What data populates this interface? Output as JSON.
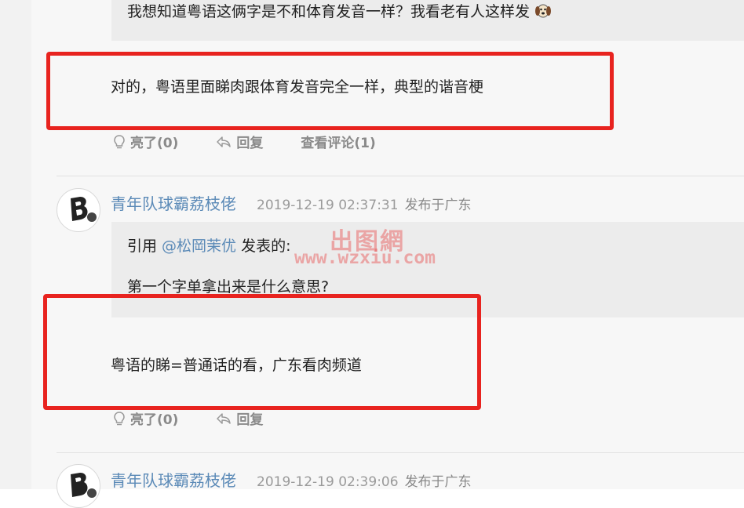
{
  "thread": {
    "quote_top_text": "我想知道粤语这俩字是不和体育发音一样？我看老有人这样发",
    "reply1_text": "对的，粤语里面睇肉跟体育发音完全一样，典型的谐音梗",
    "reply1_actions": {
      "like": "亮了(0)",
      "reply": "回复",
      "view_comments": "查看评论(1)"
    },
    "post2": {
      "username": "青年队球霸荔枝佬",
      "time": "2019-12-19 02:37:31",
      "location": "发布于广东",
      "quote_prefix": "引用 ",
      "quote_mention": "@松岡茉优",
      "quote_suffix": " 发表的:",
      "quote_text": "第一个字单拿出来是什么意思?",
      "body": "粤语的睇=普通话的看，广东看肉频道",
      "actions": {
        "like": "亮了(0)",
        "reply": "回复"
      }
    },
    "post3": {
      "username": "青年队球霸荔枝佬",
      "time": "2019-12-19 02:39:06",
      "location": "发布于广东"
    }
  },
  "watermark": {
    "cn": "出图網",
    "url": "www.wzxiu.com"
  },
  "colors": {
    "accent": "#5b8ab7",
    "highlight": "#e8231f"
  }
}
